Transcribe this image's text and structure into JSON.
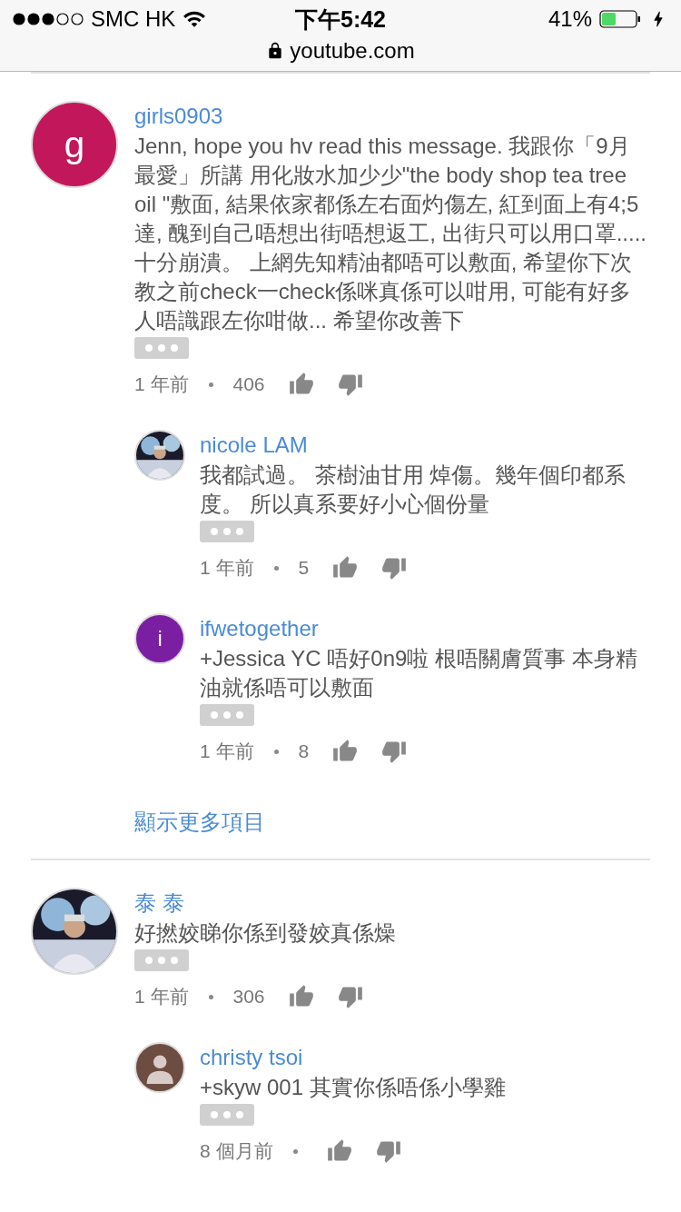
{
  "status_bar": {
    "carrier": "SMC HK",
    "time": "下午5:42",
    "battery": "41%",
    "url": "youtube.com"
  },
  "threads": [
    {
      "author": "girls0903",
      "avatar": {
        "kind": "letter",
        "letter": "g",
        "color": "#c2185b"
      },
      "text": "Jenn, hope you hv read this message. 我跟你「9月最愛」所講 用化妝水加少少\"the body shop tea tree oil \"敷面, 結果依家都係左右面灼傷左, 紅到面上有4;5達, 醜到自己唔想出街唔想返工, 出街只可以用口罩.....十分崩潰。 上網先知精油都唔可以敷面, 希望你下次教之前check一check係咪真係可以咁用, 可能有好多人唔識跟左你咁做... 希望你改善下",
      "age": "1 年前",
      "likes": "406",
      "replies": [
        {
          "author": "nicole LAM",
          "avatar": {
            "kind": "picture"
          },
          "text": "我都試過。 茶樹油甘用 焯傷。幾年個印都系度。 所以真系要好小心個份量",
          "age": "1 年前",
          "likes": "5"
        },
        {
          "author": "ifwetogether",
          "avatar": {
            "kind": "letter",
            "letter": "i",
            "color": "#7b1fa2"
          },
          "text": "+Jessica YC 唔好0n9啦 根唔關膚質事 本身精油就係唔可以敷面",
          "age": "1 年前",
          "likes": "8"
        }
      ],
      "show_more": "顯示更多項目"
    },
    {
      "author": "泰 泰",
      "avatar": {
        "kind": "picture"
      },
      "text": "好撚姣睇你係到發姣真係燥",
      "age": "1 年前",
      "likes": "306",
      "replies": [
        {
          "author": "christy tsoi",
          "avatar": {
            "kind": "default"
          },
          "text": "+skyw 001 其實你係唔係小學雞",
          "age": "8 個月前"
        }
      ]
    }
  ]
}
